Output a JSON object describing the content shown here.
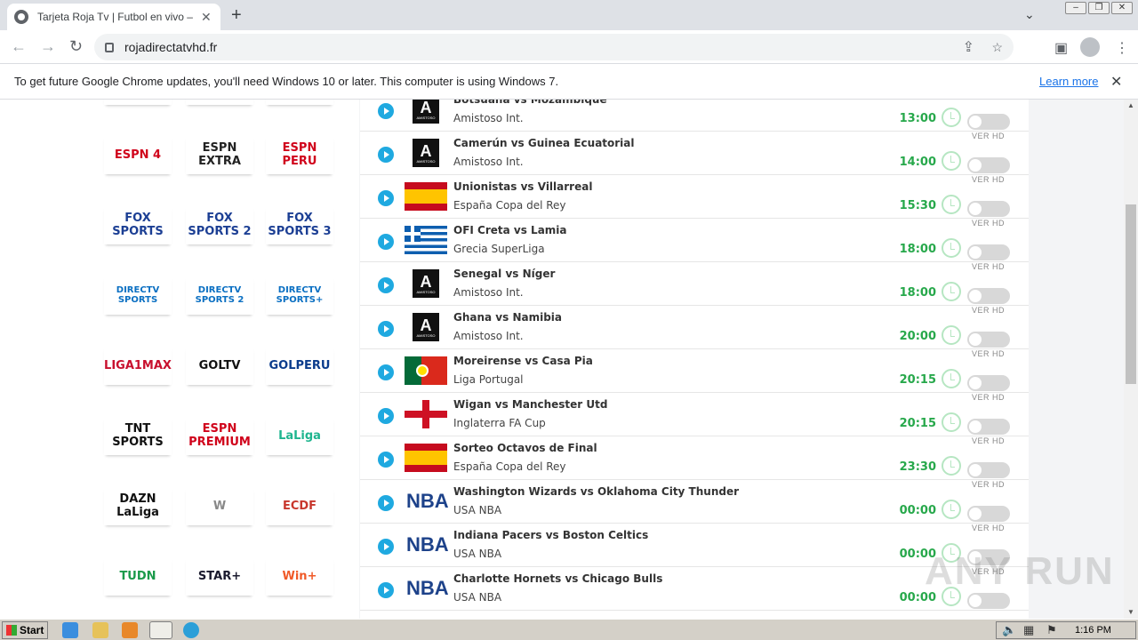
{
  "browser": {
    "tab_title": "Tarjeta Roja Tv | Futbol en vivo – Pir",
    "new_tab": "+",
    "url": "rojadirectatvhd.fr"
  },
  "infobar": {
    "message": "To get future Google Chrome updates, you'll need Windows 10 or later. This computer is using Windows 7.",
    "learn_more": "Learn more"
  },
  "channels": [
    {
      "label": "ESPN 4",
      "color": "#d0021b"
    },
    {
      "label": "ESPN EXTRA",
      "color": "#222222"
    },
    {
      "label": "ESPN PERU",
      "color": "#d0021b"
    },
    {
      "label": "FOX SPORTS",
      "color": "#1c3f94"
    },
    {
      "label": "FOX SPORTS 2",
      "color": "#1c3f94"
    },
    {
      "label": "FOX SPORTS 3",
      "color": "#1c3f94"
    },
    {
      "label": "DIRECTV SPORTS",
      "color": "#0a6fc2"
    },
    {
      "label": "DIRECTV SPORTS 2",
      "color": "#0a6fc2"
    },
    {
      "label": "DIRECTV SPORTS+",
      "color": "#0a6fc2"
    },
    {
      "label": "LIGA1MAX",
      "color": "#c8102e"
    },
    {
      "label": "GOLTV",
      "color": "#111111"
    },
    {
      "label": "GOLPERU",
      "color": "#0b3c8c"
    },
    {
      "label": "TNT SPORTS",
      "color": "#111111"
    },
    {
      "label": "ESPN PREMIUM",
      "color": "#d0021b"
    },
    {
      "label": "LaLiga",
      "color": "#1fb58f"
    },
    {
      "label": "DAZN LaLiga",
      "color": "#111111"
    },
    {
      "label": "W",
      "color": "#888888"
    },
    {
      "label": "ECDF",
      "color": "#c8372d"
    },
    {
      "label": "TUDN",
      "color": "#1a9a4a"
    },
    {
      "label": "STAR+",
      "color": "#1a1a2e"
    },
    {
      "label": "Win+",
      "color": "#f05a28"
    }
  ],
  "matches": [
    {
      "name": "Botsuana vs Mozambique",
      "league": "Amistoso Int.",
      "time": "13:00",
      "flag": "amistoso"
    },
    {
      "name": "Camerún vs Guinea Ecuatorial",
      "league": "Amistoso Int.",
      "time": "14:00",
      "flag": "amistoso"
    },
    {
      "name": "Unionistas vs Villarreal",
      "league": "España Copa del Rey",
      "time": "15:30",
      "flag": "spain"
    },
    {
      "name": "OFI Creta vs Lamia",
      "league": "Grecia SuperLiga",
      "time": "18:00",
      "flag": "greece"
    },
    {
      "name": "Senegal vs Níger",
      "league": "Amistoso Int.",
      "time": "18:00",
      "flag": "amistoso"
    },
    {
      "name": "Ghana vs Namibia",
      "league": "Amistoso Int.",
      "time": "20:00",
      "flag": "amistoso"
    },
    {
      "name": "Moreirense vs Casa Pia",
      "league": "Liga Portugal",
      "time": "20:15",
      "flag": "portugal"
    },
    {
      "name": "Wigan vs Manchester Utd",
      "league": "Inglaterra FA Cup",
      "time": "20:15",
      "flag": "england"
    },
    {
      "name": "Sorteo Octavos de Final",
      "league": "España Copa del Rey",
      "time": "23:30",
      "flag": "spain"
    },
    {
      "name": "Washington Wizards vs Oklahoma City Thunder",
      "league": "USA NBA",
      "time": "00:00",
      "flag": "nba"
    },
    {
      "name": "Indiana Pacers vs Boston Celtics",
      "league": "USA NBA",
      "time": "00:00",
      "flag": "nba"
    },
    {
      "name": "Charlotte Hornets vs Chicago Bulls",
      "league": "USA NBA",
      "time": "00:00",
      "flag": "nba"
    }
  ],
  "ver_hd": "VER HD",
  "amistoso_label": "AMISTOSO",
  "nba_label": "NBA",
  "taskbar": {
    "start": "Start",
    "clock": "1:16 PM"
  },
  "watermark": "ANY RUN"
}
